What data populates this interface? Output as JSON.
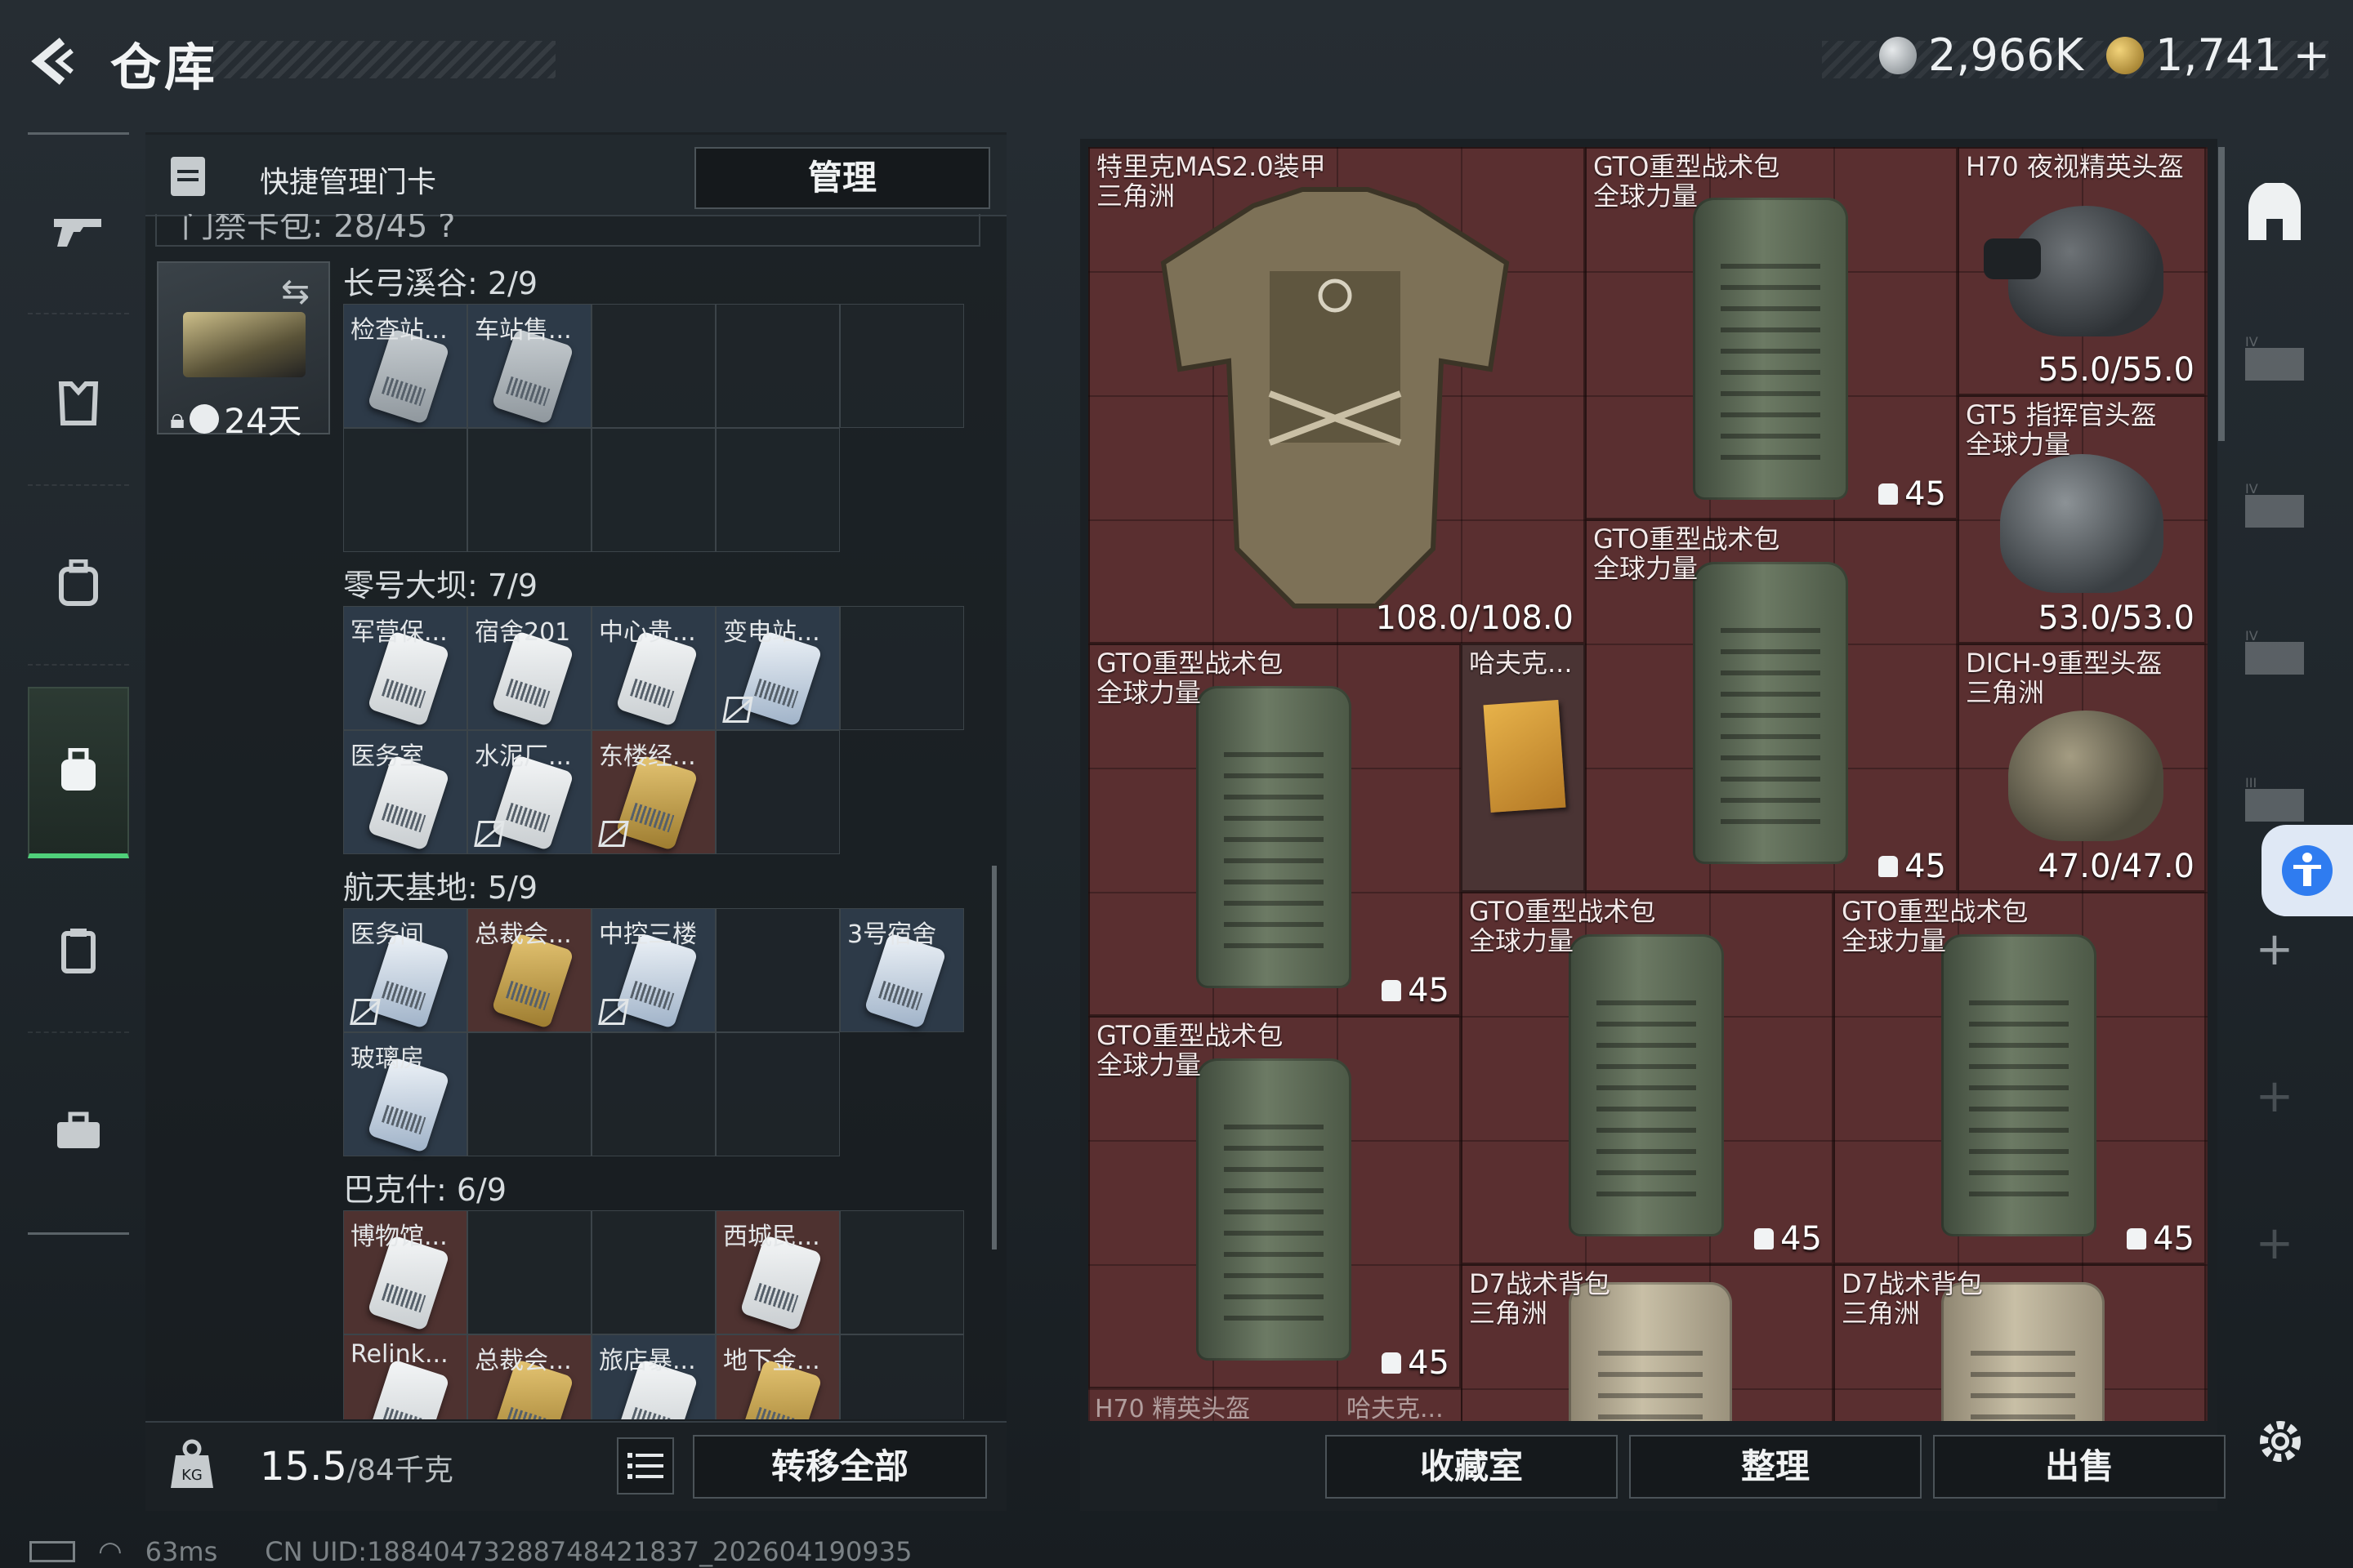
{
  "header": {
    "title": "仓库",
    "currency_silver": "2,966K",
    "currency_gold": "1,741",
    "currency_plus": "+"
  },
  "left_panel": {
    "header_label": "快捷管理门卡",
    "manage_button": "管理",
    "card_pack_label": "门禁卡包: 28/45 ?",
    "keycase_days": "24天",
    "sections": [
      {
        "title": "长弓溪谷: 2/9",
        "slots": [
          "检查站...",
          "车站售..."
        ]
      },
      {
        "title": "零号大坝: 7/9",
        "slots": [
          "军营保...",
          "宿舍201",
          "中心贵...",
          "变电站...",
          "医务室",
          "水泥厂...",
          "东楼经..."
        ]
      },
      {
        "title": "航天基地: 5/9",
        "slots": [
          "医务间",
          "总裁会...",
          "中控三楼",
          "3号宿舍",
          "玻璃房"
        ]
      },
      {
        "title": "巴克什: 6/9",
        "slots": [
          "博物馆...",
          "西城民...",
          "Relink...",
          "总裁会...",
          "旅店暴...",
          "地下金..."
        ]
      }
    ],
    "weight_value": "15.5",
    "weight_unit": "/84千克",
    "transfer_all_button": "转移全部"
  },
  "items": [
    {
      "name": "特里克MAS2.0装甲",
      "sub": "三角洲",
      "value": "108.0/108.0"
    },
    {
      "name": "GTO重型战术包",
      "sub": "全球力量",
      "cap": "45"
    },
    {
      "name": "H70 夜视精英头盔",
      "sub": "",
      "value": "55.0/55.0"
    },
    {
      "name": "GT5 指挥官头盔",
      "sub": "全球力量",
      "value": "53.0/53.0"
    },
    {
      "name": "GTO重型战术包",
      "sub": "全球力量",
      "cap": "45"
    },
    {
      "name": "GTO重型战术包",
      "sub": "全球力量",
      "cap": "45"
    },
    {
      "name": "哈夫克...",
      "sub": ""
    },
    {
      "name": "DICH-9重型头盔",
      "sub": "三角洲",
      "value": "47.0/47.0"
    },
    {
      "name": "GTO重型战术包",
      "sub": "全球力量",
      "cap": "45"
    },
    {
      "name": "GTO重型战术包",
      "sub": "全球力量",
      "cap": "45"
    },
    {
      "name": "GTO重型战术包",
      "sub": "全球力量",
      "cap": "45"
    },
    {
      "name": "D7战术背包",
      "sub": "三角洲"
    },
    {
      "name": "D7战术背包",
      "sub": "三角洲"
    }
  ],
  "lower_labels": [
    "H70 精英头盔",
    "哈夫克..."
  ],
  "right_buttons": {
    "collection": "收藏室",
    "arrange": "整理",
    "sell": "出售"
  },
  "side_plus": "+",
  "status": {
    "ping": "63ms",
    "uid": "CN UID:18840473288748421837_202604190935"
  }
}
